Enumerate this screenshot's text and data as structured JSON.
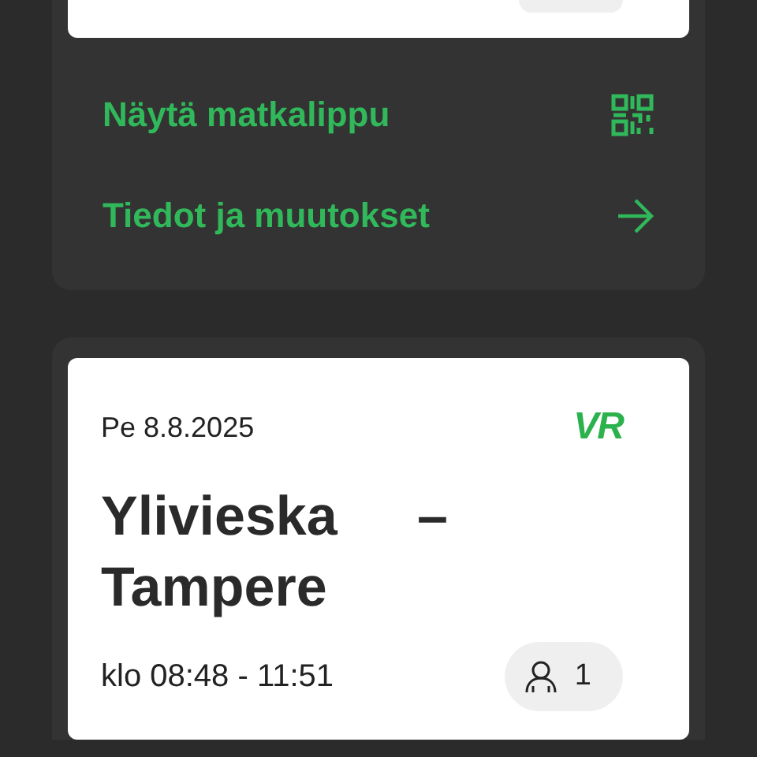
{
  "previous_trip": {
    "actions": [
      {
        "label": "Näytä matkalippu",
        "kind": "qr"
      },
      {
        "label": "Tiedot ja muutokset",
        "kind": "arrow"
      }
    ]
  },
  "trip": {
    "date": "Pe 8.8.2025",
    "logo": "VR",
    "route": "Ylivieska – Tampere",
    "time": "klo 08:48 - 11:51",
    "passengers": "1"
  }
}
